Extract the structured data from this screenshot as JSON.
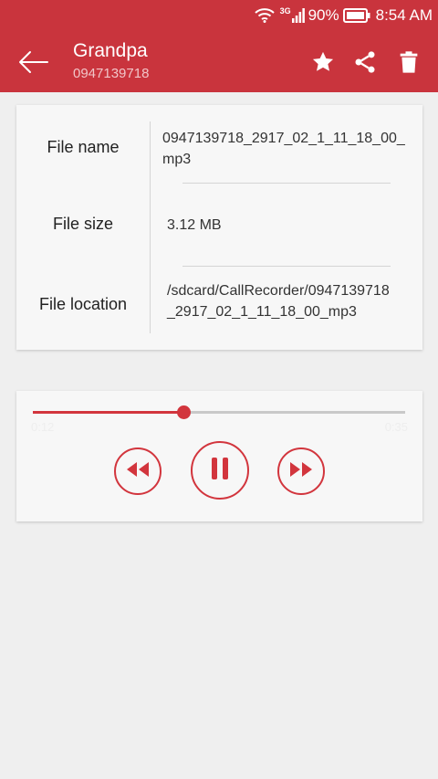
{
  "status_bar": {
    "network": "3G",
    "battery": "90%",
    "time": "8:54 AM"
  },
  "app_bar": {
    "title": "Grandpa",
    "subtitle": "0947139718",
    "icons": [
      "back-arrow-icon",
      "star-icon",
      "share-icon",
      "delete-icon"
    ]
  },
  "file_info": {
    "rows": [
      {
        "label": "File name",
        "value": "0947139718_2917_02_1_11_18_00_mp3"
      },
      {
        "label": "File size",
        "value": "3.12 MB"
      },
      {
        "label": "File location",
        "value": "/sdcard/CallRecorder/0947139718_2917_02_1_11_18_00_mp3"
      }
    ]
  },
  "player": {
    "elapsed": "0:12",
    "duration": "0:35",
    "progress": 0.405,
    "controls": [
      "rewind-icon",
      "pause-icon",
      "fast-forward-icon"
    ]
  },
  "colors": {
    "accent": "#c9343d",
    "background": "#efefef",
    "card": "#f7f7f7"
  }
}
